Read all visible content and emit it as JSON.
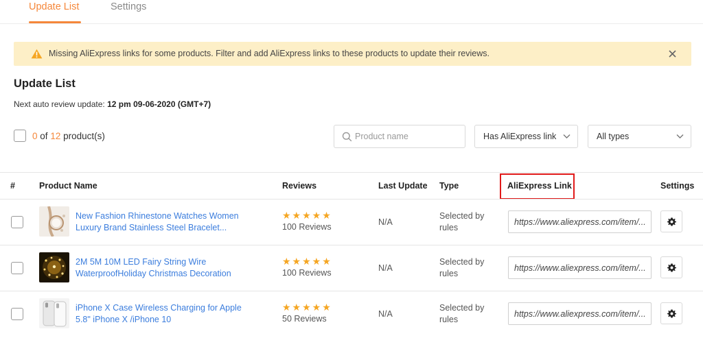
{
  "tabs": [
    {
      "label": "Update List",
      "active": true
    },
    {
      "label": "Settings",
      "active": false
    }
  ],
  "alert": {
    "text": "Missing AliExpress links for some products. Filter and add AliExpress links to these products to update their reviews.",
    "icon": "warning-icon",
    "close_icon": "close-icon"
  },
  "header": {
    "title": "Update List",
    "next_update_label": "Next auto review update:",
    "next_update_value": "12 pm 09-06-2020 (GMT+7)"
  },
  "selection": {
    "selected": "0",
    "of": "of",
    "total": "12",
    "unit": "product(s)"
  },
  "filters": {
    "search_placeholder": "Product name",
    "link_filter": "Has AliExpress link",
    "type_filter": "All types"
  },
  "table": {
    "columns": [
      "#",
      "Product Name",
      "Reviews",
      "Last Update",
      "Type",
      "AliExpress Link",
      "Settings"
    ],
    "highlighted_column": "AliExpress Link",
    "rows": [
      {
        "name": "New Fashion Rhinestone Watches Women Luxury Brand Stainless Steel Bracelet...",
        "rating": 5,
        "stars": "★★★★★",
        "reviews": "100 Reviews",
        "last_update": "N/A",
        "type": "Selected by rules",
        "link": "https://www.aliexpress.com/item/..."
      },
      {
        "name": "2M 5M 10M LED Fairy String Wire WaterproofHoliday Christmas Decoration",
        "rating": 5,
        "stars": "★★★★★",
        "reviews": "100 Reviews",
        "last_update": "N/A",
        "type": "Selected by rules",
        "link": "https://www.aliexpress.com/item/..."
      },
      {
        "name": "iPhone X Case Wireless Charging for Apple 5.8\" iPhone X /iPhone 10",
        "rating": 5,
        "stars": "★★★★★",
        "reviews": "50 Reviews",
        "last_update": "N/A",
        "type": "Selected by rules",
        "link": "https://www.aliexpress.com/item/..."
      }
    ]
  },
  "colors": {
    "accent": "#f5873a",
    "link": "#3b7ddd",
    "star": "#f5a623",
    "alert_bg": "#fdefc7",
    "highlight_border": "#e01919"
  }
}
